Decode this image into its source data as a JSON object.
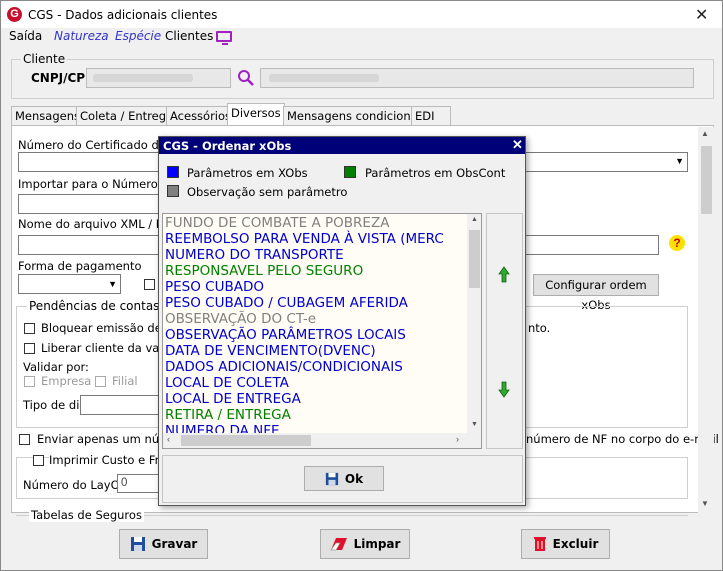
{
  "window": {
    "title": "CGS - Dados adicionais clientes",
    "logo_letter": "G"
  },
  "menu": [
    "Saída",
    "Natureza",
    "Espécie",
    "Clientes"
  ],
  "cliente": {
    "legend": "Cliente",
    "label": "CNPJ/CPF"
  },
  "tabs": [
    "Mensagens",
    "Coleta / Entrega",
    "Acessórios",
    "Diversos",
    "Mensagens condicionais",
    "EDI"
  ],
  "form": {
    "certificado": "Número do Certificado do Reg",
    "importar": "Importar para o Número de tra",
    "xml": "Nome do arquivo XML / PDF",
    "forma_pagamento": "Forma de pagamento",
    "configurar_btn": "Configurar ordem xObs",
    "pendencias": "Pendências de contas a re",
    "bloquear": "Bloquear emissão de doc",
    "bloquear_tail": "nto.",
    "liberar": "Liberar cliente da validaç",
    "validar_por": "Validar por:",
    "empresa": "Empresa",
    "filial": "Filial",
    "tipo_dia": "Tipo de dia",
    "enviar": "Enviar apenas um número",
    "enviar_tail": "número de NF no corpo do e-mail",
    "imprimir": "Imprimir Custo e Frete p",
    "layout_label": "Número do LayOut",
    "layout_value": "0",
    "tabelas": "Tabelas de Seguros"
  },
  "buttons": {
    "gravar": "Gravar",
    "limpar": "Limpar",
    "excluir": "Excluir"
  },
  "dialog": {
    "title": "CGS - Ordenar xObs",
    "legend": [
      {
        "label": "Parâmetros em XObs",
        "color": "#0000ff"
      },
      {
        "label": "Parâmetros em ObsCont",
        "color": "#008000"
      },
      {
        "label": "Observação sem parâmetro",
        "color": "#808080"
      }
    ],
    "items": [
      {
        "text": "FUNDO DE COMBATE A POBREZA",
        "color": "#808080"
      },
      {
        "text": "REEMBOLSO PARA VENDA À VISTA (MERC",
        "color": "#0000cc"
      },
      {
        "text": "NUMERO DO TRANSPORTE",
        "color": "#0000cc"
      },
      {
        "text": "RESPONSAVEL PELO SEGURO",
        "color": "#008000"
      },
      {
        "text": "PESO CUBADO",
        "color": "#0000cc"
      },
      {
        "text": "PESO CUBADO / CUBAGEM AFERIDA",
        "color": "#0000cc"
      },
      {
        "text": "OBSERVAÇÃO DO CT-e",
        "color": "#808080"
      },
      {
        "text": "OBSERVAÇÃO PARÂMETROS LOCAIS",
        "color": "#0000cc"
      },
      {
        "text": "DATA DE VENCIMENTO(DVENC)",
        "color": "#0000cc"
      },
      {
        "text": "DADOS ADICIONAIS/CONDICIONAIS",
        "color": "#0000cc"
      },
      {
        "text": "LOCAL DE COLETA",
        "color": "#0000cc"
      },
      {
        "text": "LOCAL DE ENTREGA",
        "color": "#0000cc"
      },
      {
        "text": "RETIRA / ENTREGA",
        "color": "#008000"
      },
      {
        "text": "NUMERO DA NFE",
        "color": "#0000cc"
      }
    ],
    "ok_label": "Ok"
  }
}
